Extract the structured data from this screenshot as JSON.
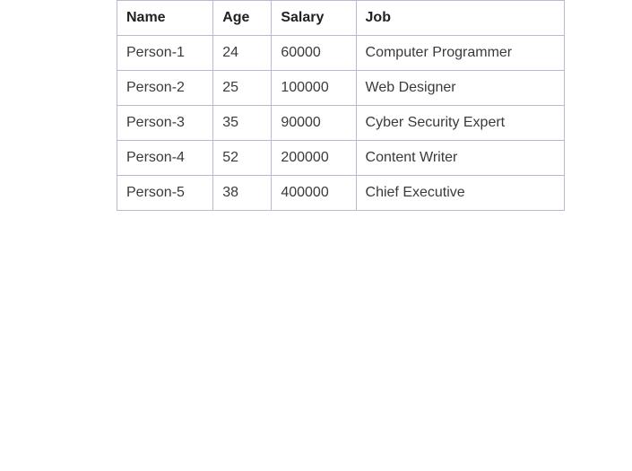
{
  "table": {
    "headers": [
      "Name",
      "Age",
      "Salary",
      "Job"
    ],
    "rows": [
      [
        "Person-1",
        "24",
        "60000",
        "Computer Programmer"
      ],
      [
        "Person-2",
        "25",
        "100000",
        "Web Designer"
      ],
      [
        "Person-3",
        "35",
        "90000",
        "Cyber Security Expert"
      ],
      [
        "Person-4",
        "52",
        "200000",
        "Content Writer"
      ],
      [
        "Person-5",
        "38",
        "400000",
        "Chief Executive"
      ]
    ]
  },
  "colors": {
    "border": "#b9b9cf",
    "header_text": "#222222",
    "cell_text": "#3a3a3a",
    "background": "#ffffff"
  }
}
